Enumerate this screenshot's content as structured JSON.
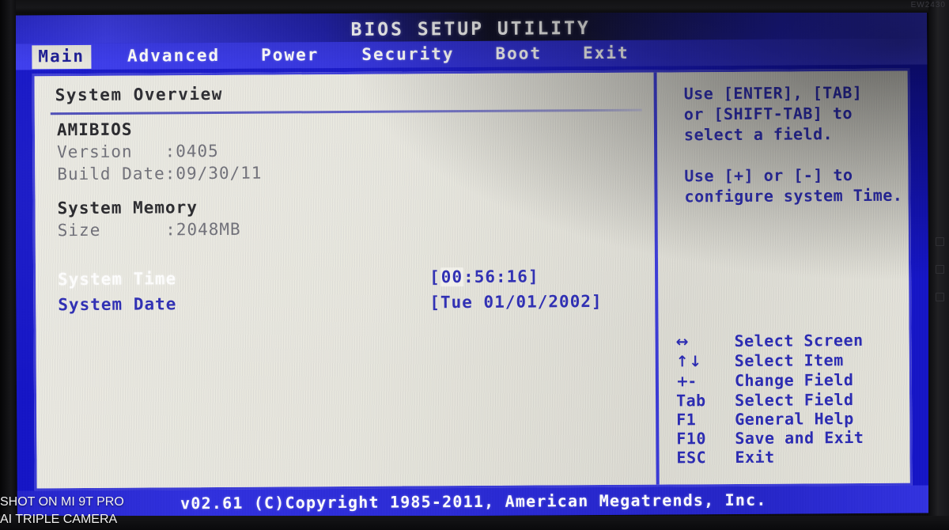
{
  "window": {
    "title": "BIOS SETUP UTILITY",
    "monitor_label": "EW2430"
  },
  "menu": {
    "items": [
      {
        "label": "Main",
        "active": true
      },
      {
        "label": "Advanced",
        "active": false
      },
      {
        "label": "Power",
        "active": false
      },
      {
        "label": "Security",
        "active": false
      },
      {
        "label": "Boot",
        "active": false
      },
      {
        "label": "Exit",
        "active": false
      }
    ]
  },
  "main": {
    "section_title": "System Overview",
    "groups": [
      {
        "heading": "AMIBIOS",
        "rows": [
          {
            "label": "Version   ",
            "value": ":0405"
          },
          {
            "label": "Build Date",
            "value": ":09/30/11"
          }
        ]
      },
      {
        "heading": "System Memory",
        "rows": [
          {
            "label": "Size      ",
            "value": ":2048MB"
          }
        ]
      }
    ],
    "fields": [
      {
        "label": "System Time",
        "selected": true,
        "value_prefix": "[",
        "value_cursor": "00",
        "value_suffix": ":56:16]"
      },
      {
        "label": "System Date",
        "selected": false,
        "value_prefix": "[Tue 01/01/2002]",
        "value_cursor": "",
        "value_suffix": ""
      }
    ]
  },
  "help": {
    "paragraph1": "Use [ENTER], [TAB]\nor [SHIFT-TAB] to\nselect a field.",
    "paragraph2": "Use [+] or [-] to\nconfigure system Time.",
    "keys": [
      {
        "glyph": "↔",
        "desc": "Select Screen"
      },
      {
        "glyph": "↑↓",
        "desc": "Select Item"
      },
      {
        "glyph": "+-",
        "desc": "Change Field"
      },
      {
        "glyph": "Tab",
        "desc": "Select Field"
      },
      {
        "glyph": "F1",
        "desc": "General Help"
      },
      {
        "glyph": "F10",
        "desc": "Save and Exit"
      },
      {
        "glyph": "ESC",
        "desc": "Exit"
      }
    ]
  },
  "footer": {
    "copyright": "v02.61 (C)Copyright 1985-2011, American Megatrends, Inc."
  },
  "watermark": {
    "line1": "SHOT ON MI 9T PRO",
    "line2": "AI TRIPLE CAMERA"
  },
  "colors": {
    "bios_blue": "#2b2bb4",
    "panel_bg": "#e8e7de",
    "header_blue": "#2f2fdc",
    "highlight_bg": "#e9e8de"
  }
}
